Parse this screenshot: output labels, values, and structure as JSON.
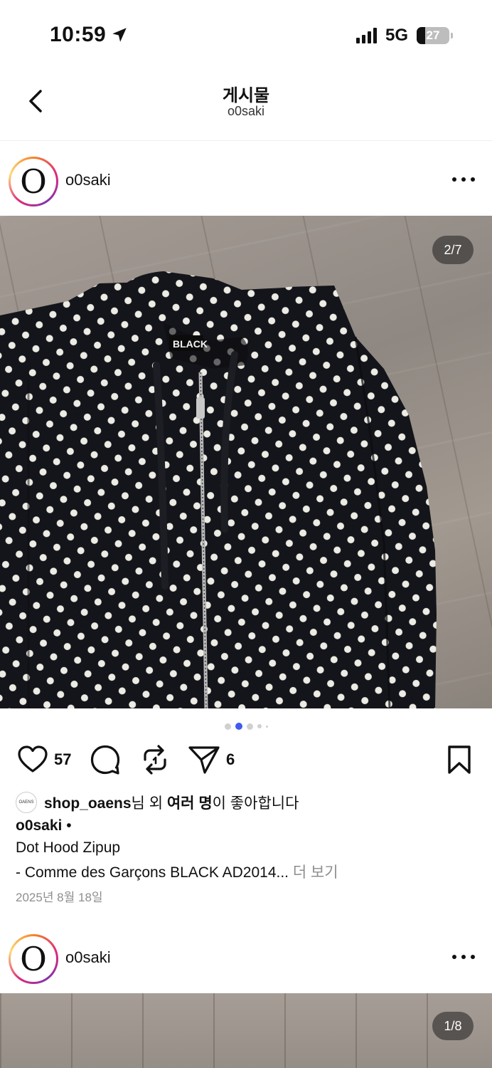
{
  "status_bar": {
    "time": "10:59",
    "network": "5G",
    "battery_level": "27",
    "battery_fraction": 0.27
  },
  "nav": {
    "title": "게시물",
    "subtitle": "o0saki",
    "back_icon": "chevron-left-icon"
  },
  "posts": [
    {
      "username": "o0saki",
      "avatar_letter": "O",
      "image_counter": "2/7",
      "carousel_total": 7,
      "carousel_active": 1,
      "likes_count": "57",
      "reposts_count": "6",
      "liked_by_avatar_text": "OAENS",
      "liked_by_user": "shop_oaens",
      "liked_by_suffix_1": "님 외 ",
      "liked_by_others": "여러 명",
      "liked_by_suffix_2": "이 좋아합니다",
      "caption_user": "o0saki",
      "caption_dot": " •",
      "caption_line1": "Dot Hood Zipup",
      "caption_line2": "- Comme des Garçons BLACK AD2014...",
      "more_label": " 더 보기",
      "date": "2025년 8월 18일"
    },
    {
      "username": "o0saki",
      "avatar_letter": "O",
      "image_counter": "1/8"
    }
  ],
  "colors": {
    "accent_blue": "#3f5bf0",
    "muted_text": "#8e8e8e",
    "hoodie": "#14151a",
    "dot": "#ecebe4"
  },
  "icons": [
    "heart-icon",
    "comment-icon",
    "repost-icon",
    "share-icon",
    "bookmark-icon",
    "more-icon",
    "location-arrow-icon"
  ]
}
